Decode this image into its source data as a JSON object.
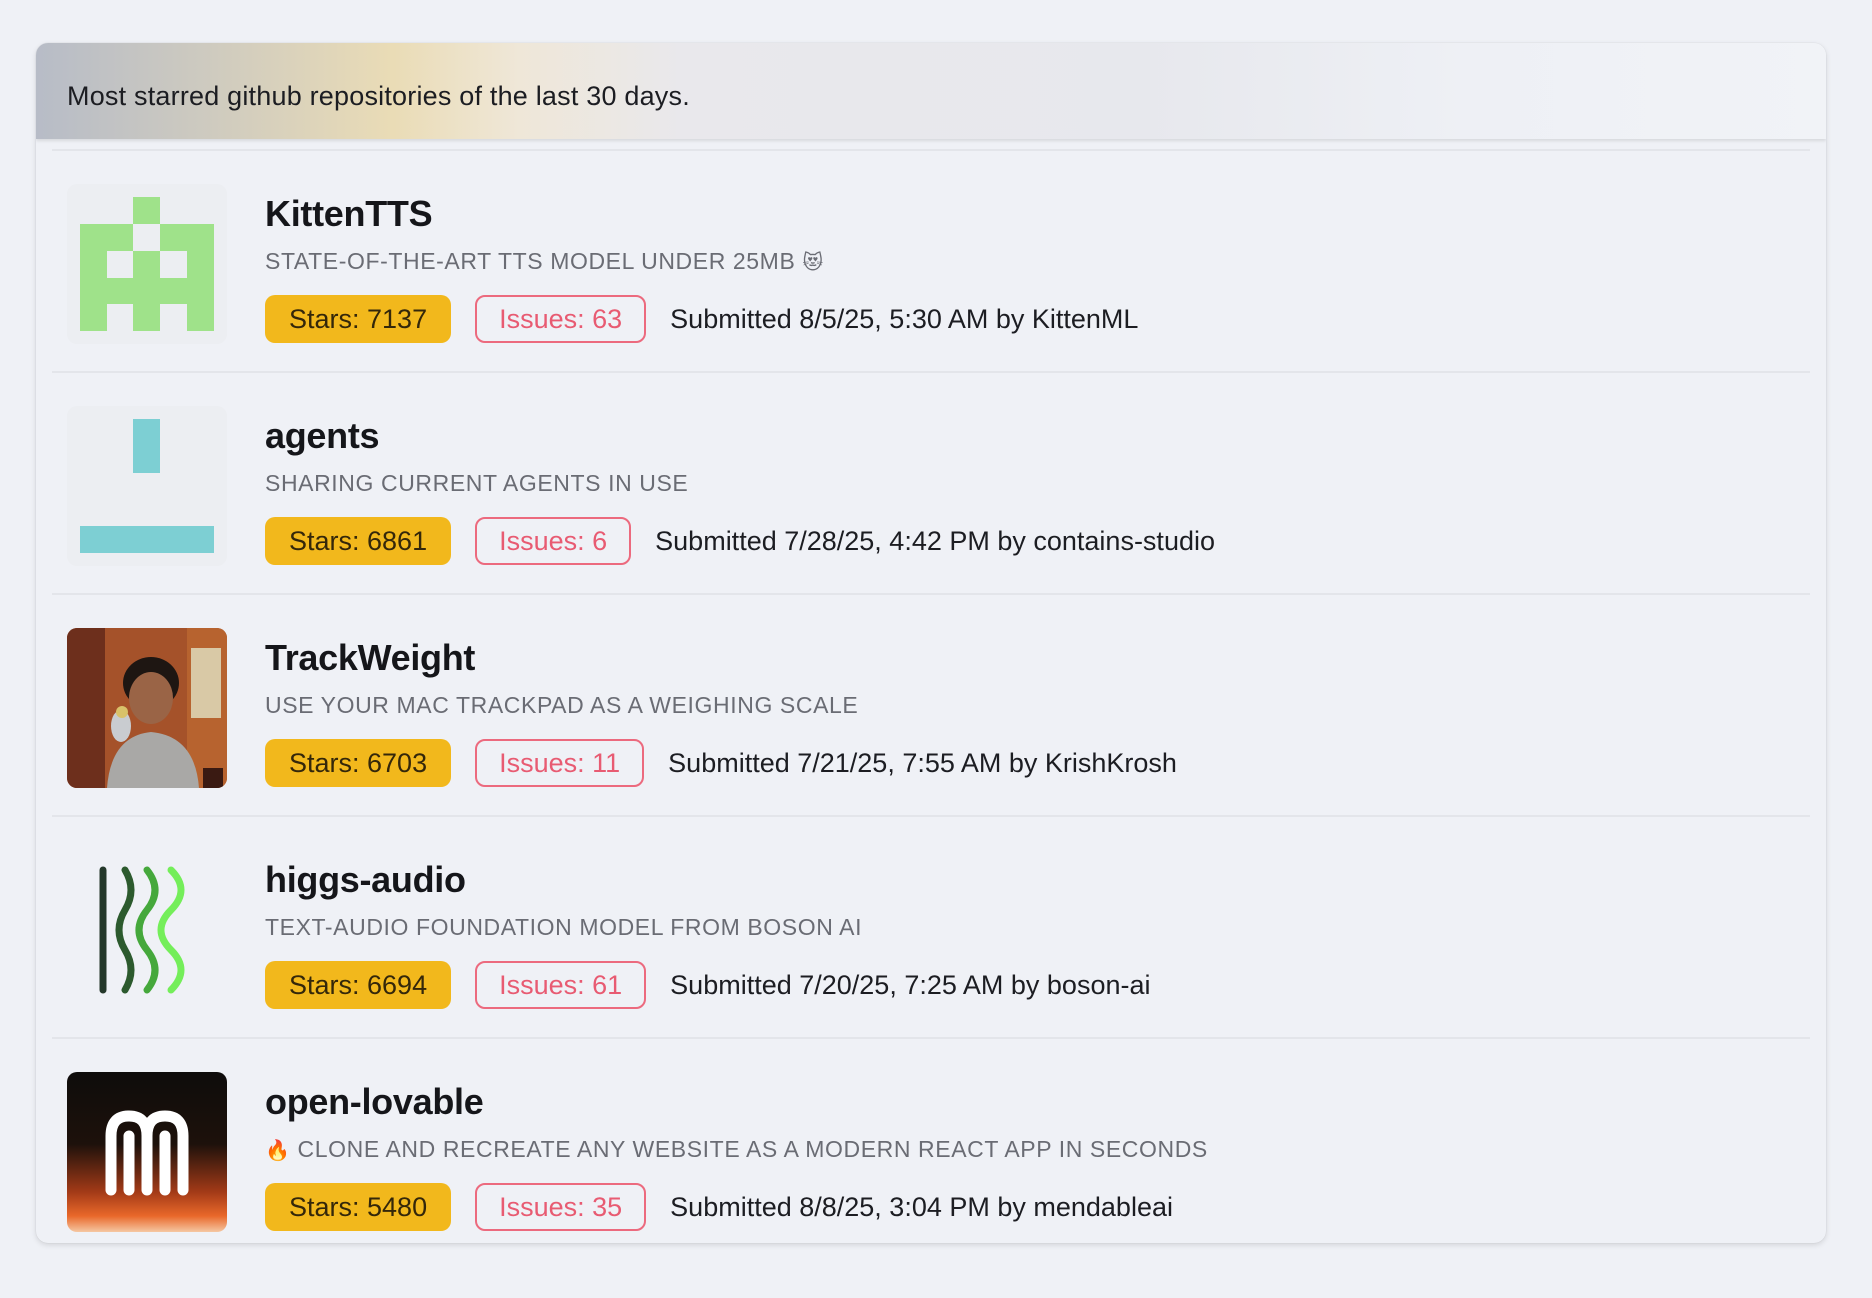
{
  "header": {
    "text": "Most starred github repositories of the last 30 days."
  },
  "colors": {
    "stars_bg": "#f2b81c",
    "issues_border": "#ec6a7e",
    "page_bg": "#eff1f6"
  },
  "repos": [
    {
      "name": "KittenTTS",
      "description": "State-of-the-art TTS model under 25MB",
      "description_emoji": "😻",
      "stars": "Stars: 7137",
      "issues": "Issues: 63",
      "submitted": "Submitted 8/5/25, 5:30 AM by KittenML",
      "avatar": "green-pixel-identicon"
    },
    {
      "name": "agents",
      "description": "Sharing current agents in use",
      "stars": "Stars: 6861",
      "issues": "Issues: 6",
      "submitted": "Submitted 7/28/25, 4:42 PM by contains-studio",
      "avatar": "teal-pixel-identicon"
    },
    {
      "name": "TrackWeight",
      "description": "Use your Mac trackpad as a weighing scale",
      "stars": "Stars: 6703",
      "issues": "Issues: 11",
      "submitted": "Submitted 7/21/25, 7:55 AM by KrishKrosh",
      "avatar": "profile-photo"
    },
    {
      "name": "higgs-audio",
      "description": "Text-audio foundation model from Boson AI",
      "stars": "Stars: 6694",
      "issues": "Issues: 61",
      "submitted": "Submitted 7/20/25, 7:25 AM by boson-ai",
      "avatar": "boson-wave-logo"
    },
    {
      "name": "open-lovable",
      "description": "Clone and recreate any website as a modern React app in seconds",
      "description_emoji": "🔥",
      "stars": "Stars: 5480",
      "issues": "Issues: 35",
      "submitted": "Submitted 8/8/25, 3:04 PM by mendableai",
      "avatar": "mendable-m-logo"
    }
  ]
}
